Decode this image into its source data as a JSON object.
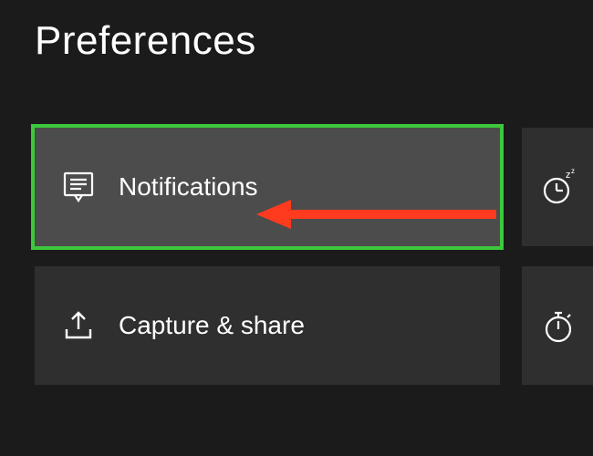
{
  "page": {
    "title": "Preferences"
  },
  "tiles": {
    "notifications": {
      "label": "Notifications"
    },
    "capture_share": {
      "label": "Capture & share"
    }
  },
  "annotation": {
    "arrow_color": "#ff3b1f"
  }
}
